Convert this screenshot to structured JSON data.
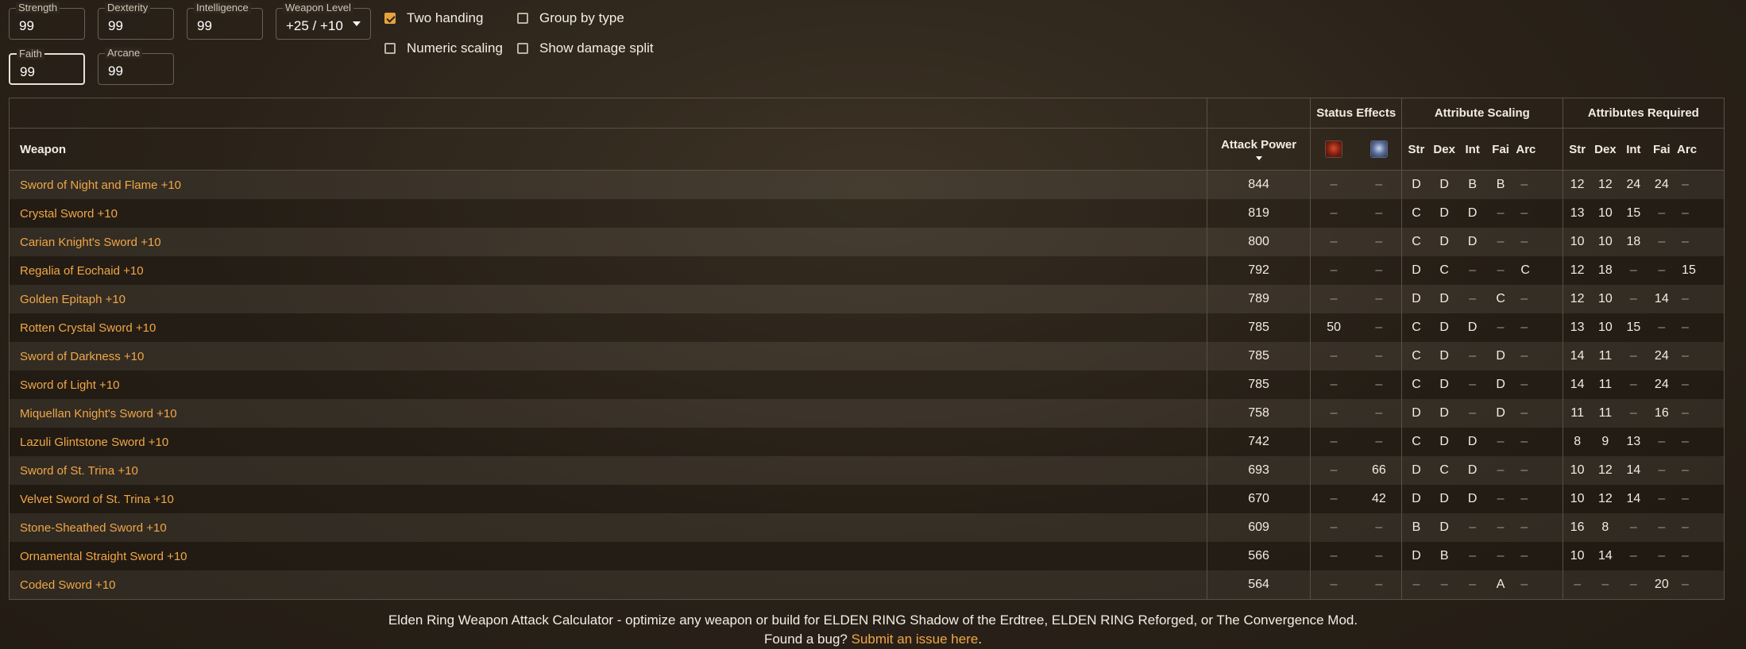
{
  "attributes": {
    "strength": {
      "label": "Strength",
      "value": "99"
    },
    "dexterity": {
      "label": "Dexterity",
      "value": "99"
    },
    "intelligence": {
      "label": "Intelligence",
      "value": "99"
    },
    "faith": {
      "label": "Faith",
      "value": "99"
    },
    "arcane": {
      "label": "Arcane",
      "value": "99"
    }
  },
  "weapon_level": {
    "label": "Weapon Level",
    "value": "+25 / +10"
  },
  "options": {
    "two_handing": {
      "label": "Two handing",
      "checked": true
    },
    "group_by_type": {
      "label": "Group by type",
      "checked": false
    },
    "numeric_scaling": {
      "label": "Numeric scaling",
      "checked": false
    },
    "show_damage_split": {
      "label": "Show damage split",
      "checked": false
    }
  },
  "table": {
    "group_headers": {
      "status_effects": "Status Effects",
      "attribute_scaling": "Attribute Scaling",
      "attributes_required": "Attributes Required"
    },
    "columns": {
      "weapon": "Weapon",
      "attack_power": "Attack Power",
      "status_icons": [
        "scarlet-rot-icon",
        "frostbite-icon"
      ],
      "scaling": [
        "Str",
        "Dex",
        "Int",
        "Fai",
        "Arc"
      ],
      "required": [
        "Str",
        "Dex",
        "Int",
        "Fai",
        "Arc"
      ]
    },
    "rows": [
      {
        "name": "Sword of Night and Flame +10",
        "ap": "844",
        "status": [
          "–",
          "–"
        ],
        "scaling": [
          "D",
          "D",
          "B",
          "B",
          "–"
        ],
        "required": [
          "12",
          "12",
          "24",
          "24",
          "–"
        ]
      },
      {
        "name": "Crystal Sword +10",
        "ap": "819",
        "status": [
          "–",
          "–"
        ],
        "scaling": [
          "C",
          "D",
          "D",
          "–",
          "–"
        ],
        "required": [
          "13",
          "10",
          "15",
          "–",
          "–"
        ]
      },
      {
        "name": "Carian Knight's Sword +10",
        "ap": "800",
        "status": [
          "–",
          "–"
        ],
        "scaling": [
          "C",
          "D",
          "D",
          "–",
          "–"
        ],
        "required": [
          "10",
          "10",
          "18",
          "–",
          "–"
        ]
      },
      {
        "name": "Regalia of Eochaid +10",
        "ap": "792",
        "status": [
          "–",
          "–"
        ],
        "scaling": [
          "D",
          "C",
          "–",
          "–",
          "C"
        ],
        "required": [
          "12",
          "18",
          "–",
          "–",
          "15"
        ]
      },
      {
        "name": "Golden Epitaph +10",
        "ap": "789",
        "status": [
          "–",
          "–"
        ],
        "scaling": [
          "D",
          "D",
          "–",
          "C",
          "–"
        ],
        "required": [
          "12",
          "10",
          "–",
          "14",
          "–"
        ]
      },
      {
        "name": "Rotten Crystal Sword +10",
        "ap": "785",
        "status": [
          "50",
          "–"
        ],
        "scaling": [
          "C",
          "D",
          "D",
          "–",
          "–"
        ],
        "required": [
          "13",
          "10",
          "15",
          "–",
          "–"
        ]
      },
      {
        "name": "Sword of Darkness +10",
        "ap": "785",
        "status": [
          "–",
          "–"
        ],
        "scaling": [
          "C",
          "D",
          "–",
          "D",
          "–"
        ],
        "required": [
          "14",
          "11",
          "–",
          "24",
          "–"
        ]
      },
      {
        "name": "Sword of Light +10",
        "ap": "785",
        "status": [
          "–",
          "–"
        ],
        "scaling": [
          "C",
          "D",
          "–",
          "D",
          "–"
        ],
        "required": [
          "14",
          "11",
          "–",
          "24",
          "–"
        ]
      },
      {
        "name": "Miquellan Knight's Sword +10",
        "ap": "758",
        "status": [
          "–",
          "–"
        ],
        "scaling": [
          "D",
          "D",
          "–",
          "D",
          "–"
        ],
        "required": [
          "11",
          "11",
          "–",
          "16",
          "–"
        ]
      },
      {
        "name": "Lazuli Glintstone Sword +10",
        "ap": "742",
        "status": [
          "–",
          "–"
        ],
        "scaling": [
          "C",
          "D",
          "D",
          "–",
          "–"
        ],
        "required": [
          "8",
          "9",
          "13",
          "–",
          "–"
        ]
      },
      {
        "name": "Sword of St. Trina +10",
        "ap": "693",
        "status": [
          "–",
          "66"
        ],
        "scaling": [
          "D",
          "C",
          "D",
          "–",
          "–"
        ],
        "required": [
          "10",
          "12",
          "14",
          "–",
          "–"
        ]
      },
      {
        "name": "Velvet Sword of St. Trina +10",
        "ap": "670",
        "status": [
          "–",
          "42"
        ],
        "scaling": [
          "D",
          "D",
          "D",
          "–",
          "–"
        ],
        "required": [
          "10",
          "12",
          "14",
          "–",
          "–"
        ]
      },
      {
        "name": "Stone-Sheathed Sword +10",
        "ap": "609",
        "status": [
          "–",
          "–"
        ],
        "scaling": [
          "B",
          "D",
          "–",
          "–",
          "–"
        ],
        "required": [
          "16",
          "8",
          "–",
          "–",
          "–"
        ]
      },
      {
        "name": "Ornamental Straight Sword +10",
        "ap": "566",
        "status": [
          "–",
          "–"
        ],
        "scaling": [
          "D",
          "B",
          "–",
          "–",
          "–"
        ],
        "required": [
          "10",
          "14",
          "–",
          "–",
          "–"
        ]
      },
      {
        "name": "Coded Sword +10",
        "ap": "564",
        "status": [
          "–",
          "–"
        ],
        "scaling": [
          "–",
          "–",
          "–",
          "A",
          "–"
        ],
        "required": [
          "–",
          "–",
          "–",
          "20",
          "–"
        ]
      }
    ]
  },
  "footer": {
    "line1": "Elden Ring Weapon Attack Calculator - optimize any weapon or build for ELDEN RING Shadow of the Erdtree, ELDEN RING Reforged, or The Convergence Mod.",
    "line2_prefix": "Found a bug? ",
    "line2_link": "Submit an issue here",
    "line2_suffix": "."
  }
}
